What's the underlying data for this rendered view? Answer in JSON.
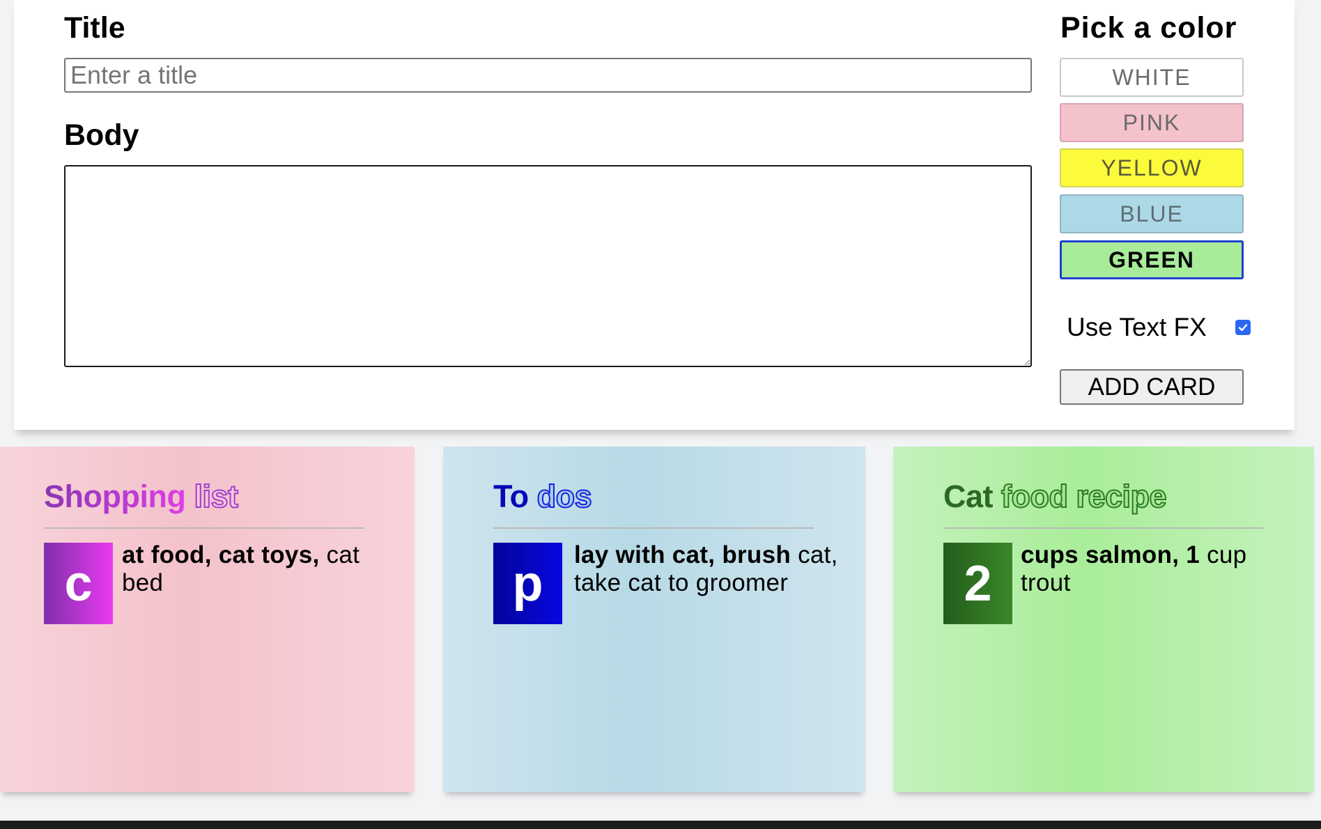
{
  "form": {
    "title_label": "Title",
    "title_placeholder": "Enter a title",
    "title_value": "",
    "body_label": "Body",
    "body_value": "",
    "color_label": "Pick a color",
    "colors": [
      {
        "label": "WHITE",
        "hex": "#ffffff"
      },
      {
        "label": "PINK",
        "hex": "#f4c2cb"
      },
      {
        "label": "YELLOW",
        "hex": "#fbfb3c"
      },
      {
        "label": "BLUE",
        "hex": "#add8e6"
      },
      {
        "label": "GREEN",
        "hex": "#a8ec9a"
      }
    ],
    "selected_color": "GREEN",
    "text_fx_label": "Use Text FX",
    "text_fx_checked": true,
    "add_button": "ADD CARD"
  },
  "cards": [
    {
      "color": "pink",
      "title_word_1": "Shopping",
      "title_word_2": "list",
      "dropcap": "c",
      "body_bold": "at food, cat toys,",
      "body_rest": "cat bed"
    },
    {
      "color": "blue",
      "title_word_1": "To",
      "title_word_2": "dos",
      "dropcap": "p",
      "body_bold": "lay with cat, brush",
      "body_rest": "cat, take cat to groomer"
    },
    {
      "color": "green",
      "title_word_1": "Cat",
      "title_word_2": "food recipe",
      "dropcap": "2",
      "body_bold": "cups salmon, 1",
      "body_rest": "cup trout"
    }
  ]
}
